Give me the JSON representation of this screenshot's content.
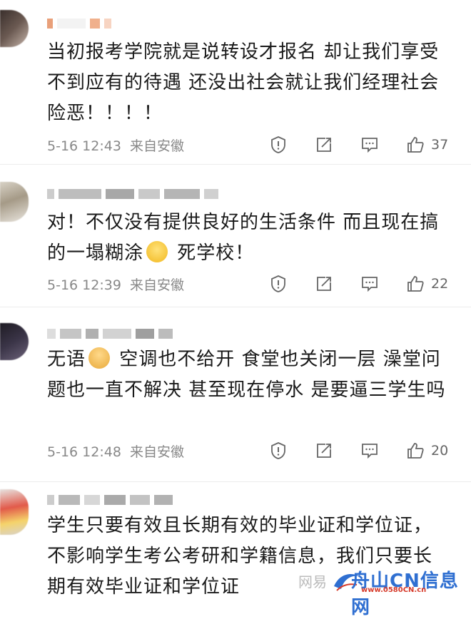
{
  "comments": [
    {
      "text": "当初报考学院就是说转设才报名 却让我们享受不到应有的待遇 还没出社会就让我们经理社会险恶！！！！",
      "time": "5-16 12:43",
      "location": "来自安徽",
      "likes": "37"
    },
    {
      "text_before": "对！不仅没有提供良好的生活条件 而且现在搞的一塌糊涂",
      "text_after": " 死学校！",
      "emoji": "crying-face-icon",
      "time": "5-16 12:39",
      "location": "来自安徽",
      "likes": "22"
    },
    {
      "text_before": "无语",
      "text_after": " 空调也不给开 食堂也关闭一层 澡堂问题也一直不解决 甚至现在停水 是要逼三学生吗",
      "emoji": "facepalm-person-icon",
      "time": "5-16 12:48",
      "location": "来自安徽",
      "likes": "20"
    },
    {
      "text": "学生只要有效且长期有效的毕业证和学位证，不影响学生考公考研和学籍信息，我们只要长期有效毕业证和学位证"
    }
  ],
  "icons": [
    "report-icon",
    "repost-icon",
    "reply-icon",
    "like-icon"
  ],
  "watermark": {
    "netease": "网易",
    "site_name": "舟山CN信息网",
    "site_url": "www.0580CN.cn"
  },
  "colors": {
    "meta_text": "#888888",
    "text": "#1a1a1a",
    "wm_blue": "#2f6fd1",
    "wm_red": "#d63a2a"
  }
}
